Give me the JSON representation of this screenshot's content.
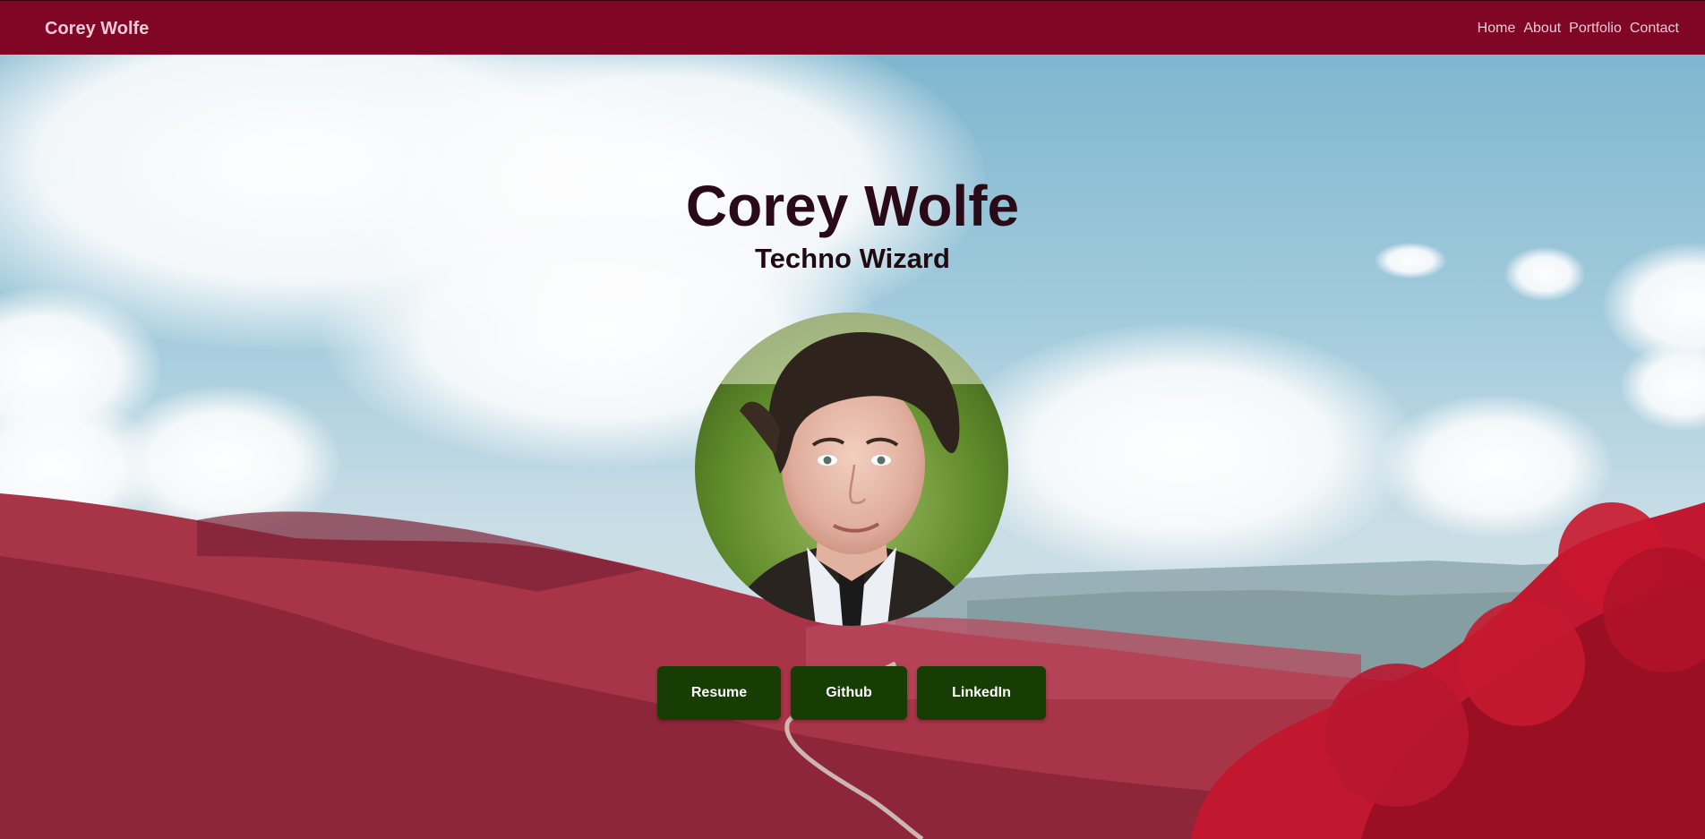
{
  "nav": {
    "brand": "Corey Wolfe",
    "links": [
      "Home",
      "About",
      "Portfolio",
      "Contact"
    ]
  },
  "hero": {
    "title": "Corey Wolfe",
    "subtitle": "Techno Wizard"
  },
  "buttons": {
    "resume": "Resume",
    "github": "Github",
    "linkedin": "LinkedIn"
  },
  "colors": {
    "navbar": "#7f0624",
    "button": "#173d05",
    "foliage": "#b0394f"
  }
}
